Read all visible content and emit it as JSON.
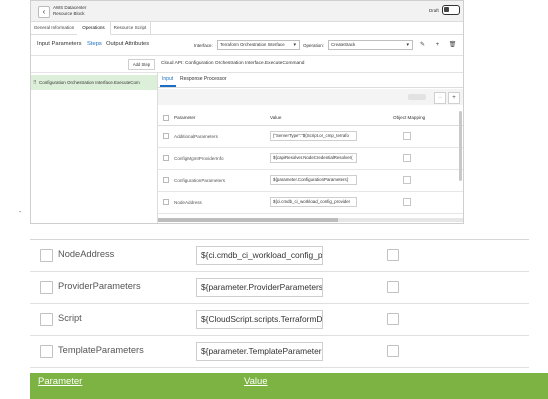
{
  "header": {
    "title_line1": "AWS Datacenter",
    "title_line2": "Resource Block",
    "draft_label": "Draft"
  },
  "main_tabs": [
    "General Information",
    "Operations",
    "Resource Script"
  ],
  "sub_tabs": [
    "Input Parameters",
    "Steps",
    "Output Attributes"
  ],
  "interface": {
    "label": "Interface:",
    "value": "Terraform Orchestration Interface"
  },
  "operation": {
    "label": "Operation:",
    "value": "CreateStack"
  },
  "add_step_label": "Add Step",
  "cloud_api_title": "Cloud API: Configuration Orchestration Interface.ExecuteCommand",
  "steps": [
    {
      "label": "Configuration Orchestration Interface.ExecuteCom"
    }
  ],
  "detail_tabs": [
    "Input",
    "Response Processor"
  ],
  "table_headers": {
    "parameter": "Parameter",
    "value": "Value",
    "object_mapping": "Object Mapping"
  },
  "small_rows": [
    {
      "name": "AdditionalParameters",
      "value": "{\"ServerType\":\"${Script.or_cmp_terrafo"
    },
    {
      "name": "ConfigMgmtProviderInfo",
      "value": "${capiResolver.NodeCredentialResolver("
    },
    {
      "name": "ConfigurationParameters",
      "value": "${parameter.ConfigurationParameters}"
    },
    {
      "name": "NodeAddress",
      "value": "${ci.cmdb_ci_workload_config_provider"
    }
  ],
  "zoom_rows": [
    {
      "name": "NodeAddress",
      "value": "${ci.cmdb_ci_workload_config_provide"
    },
    {
      "name": "ProviderParameters",
      "value": "${parameter.ProviderParameters}"
    },
    {
      "name": "Script",
      "value": "${CloudScript.scripts.TerraformDeploy}"
    },
    {
      "name": "TemplateParameters",
      "value": "${parameter.TemplateParameters}"
    }
  ],
  "green_bar": {
    "parameter": "Parameter",
    "value": "Value"
  },
  "colors": {
    "accent": "#1b6ec2",
    "green_bar": "#7cb342",
    "selected_step": "#dcefd9"
  }
}
